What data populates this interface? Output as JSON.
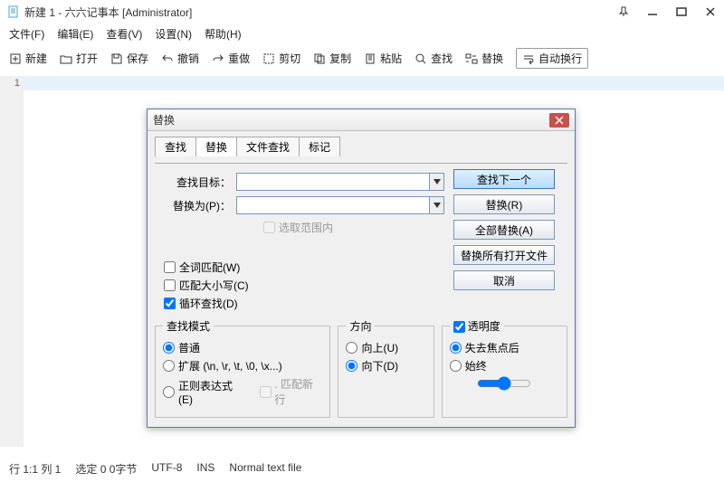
{
  "title": "新建 1 - 六六记事本 [Administrator]",
  "menu": [
    "文件(F)",
    "编辑(E)",
    "查看(V)",
    "设置(N)",
    "帮助(H)"
  ],
  "toolbar": {
    "new": "新建",
    "open": "打开",
    "save": "保存",
    "undo": "撤销",
    "redo": "重做",
    "cut": "剪切",
    "copy": "复制",
    "paste": "粘贴",
    "find": "查找",
    "replace": "替换",
    "wrap": "自动换行"
  },
  "gutter_line": "1",
  "dialog": {
    "title": "替换",
    "tabs": [
      "查找",
      "替换",
      "文件查找",
      "标记"
    ],
    "active_tab": 1,
    "find_label": "查找目标：",
    "replace_label": "替换为(P)：",
    "find_value": "",
    "replace_value": "",
    "in_selection": "选取范围内",
    "btn_find_next": "查找下一个",
    "btn_replace": "替换(R)",
    "btn_replace_all": "全部替换(A)",
    "btn_replace_open": "替换所有打开文件",
    "btn_cancel": "取消",
    "chk_whole": "全词匹配(W)",
    "chk_case": "匹配大小写(C)",
    "chk_loop": "循环查找(D)",
    "group_mode": "查找模式",
    "mode_normal": "普通",
    "mode_ext": "扩展 (\\n, \\r, \\t, \\0, \\x...)",
    "mode_regex": "正则表达式(E)",
    "mode_match_nl": ". 匹配新行",
    "group_dir": "方向",
    "dir_up": "向上(U)",
    "dir_down": "向下(D)",
    "group_trans": "透明度",
    "trans_onblur": "失去焦点后",
    "trans_always": "始终"
  },
  "status": {
    "pos": "行 1:1  列 1",
    "sel": "选定 0   0字节",
    "enc": "UTF-8",
    "mode": "INS",
    "filetype": "Normal text file"
  }
}
